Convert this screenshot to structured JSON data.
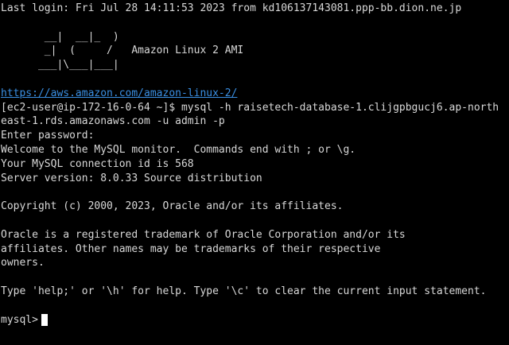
{
  "terminal": {
    "last_login": "Last login: Fri Jul 28 14:11:53 2023 from kd106137143081.ppp-bb.dion.ne.jp",
    "banner": [
      "       __|  __|_  )",
      "       _|  (     /   Amazon Linux 2 AMI",
      "      ___|\\___|___|"
    ],
    "url": "https://aws.amazon.com/amazon-linux-2/",
    "command_line_1": "[ec2-user@ip-172-16-0-64 ~]$ mysql -h raisetech-database-1.clijgpbgucj6.ap-north",
    "command_line_2": "east-1.rds.amazonaws.com -u admin -p",
    "enter_password": "Enter password:",
    "welcome": "Welcome to the MySQL monitor.  Commands end with ; or \\g.",
    "connection_id": "Your MySQL connection id is 568",
    "server_version": "Server version: 8.0.33 Source distribution",
    "copyright": "Copyright (c) 2000, 2023, Oracle and/or its affiliates.",
    "trademark_1": "Oracle is a registered trademark of Oracle Corporation and/or its",
    "trademark_2": "affiliates. Other names may be trademarks of their respective",
    "trademark_3": "owners.",
    "help_text": "Type 'help;' or '\\h' for help. Type '\\c' to clear the current input statement.",
    "prompt": "mysql>"
  },
  "colors": {
    "background": "#000000",
    "text": "#d8d8d8",
    "link": "#3a8fe3",
    "cursor": "#ffffff"
  }
}
